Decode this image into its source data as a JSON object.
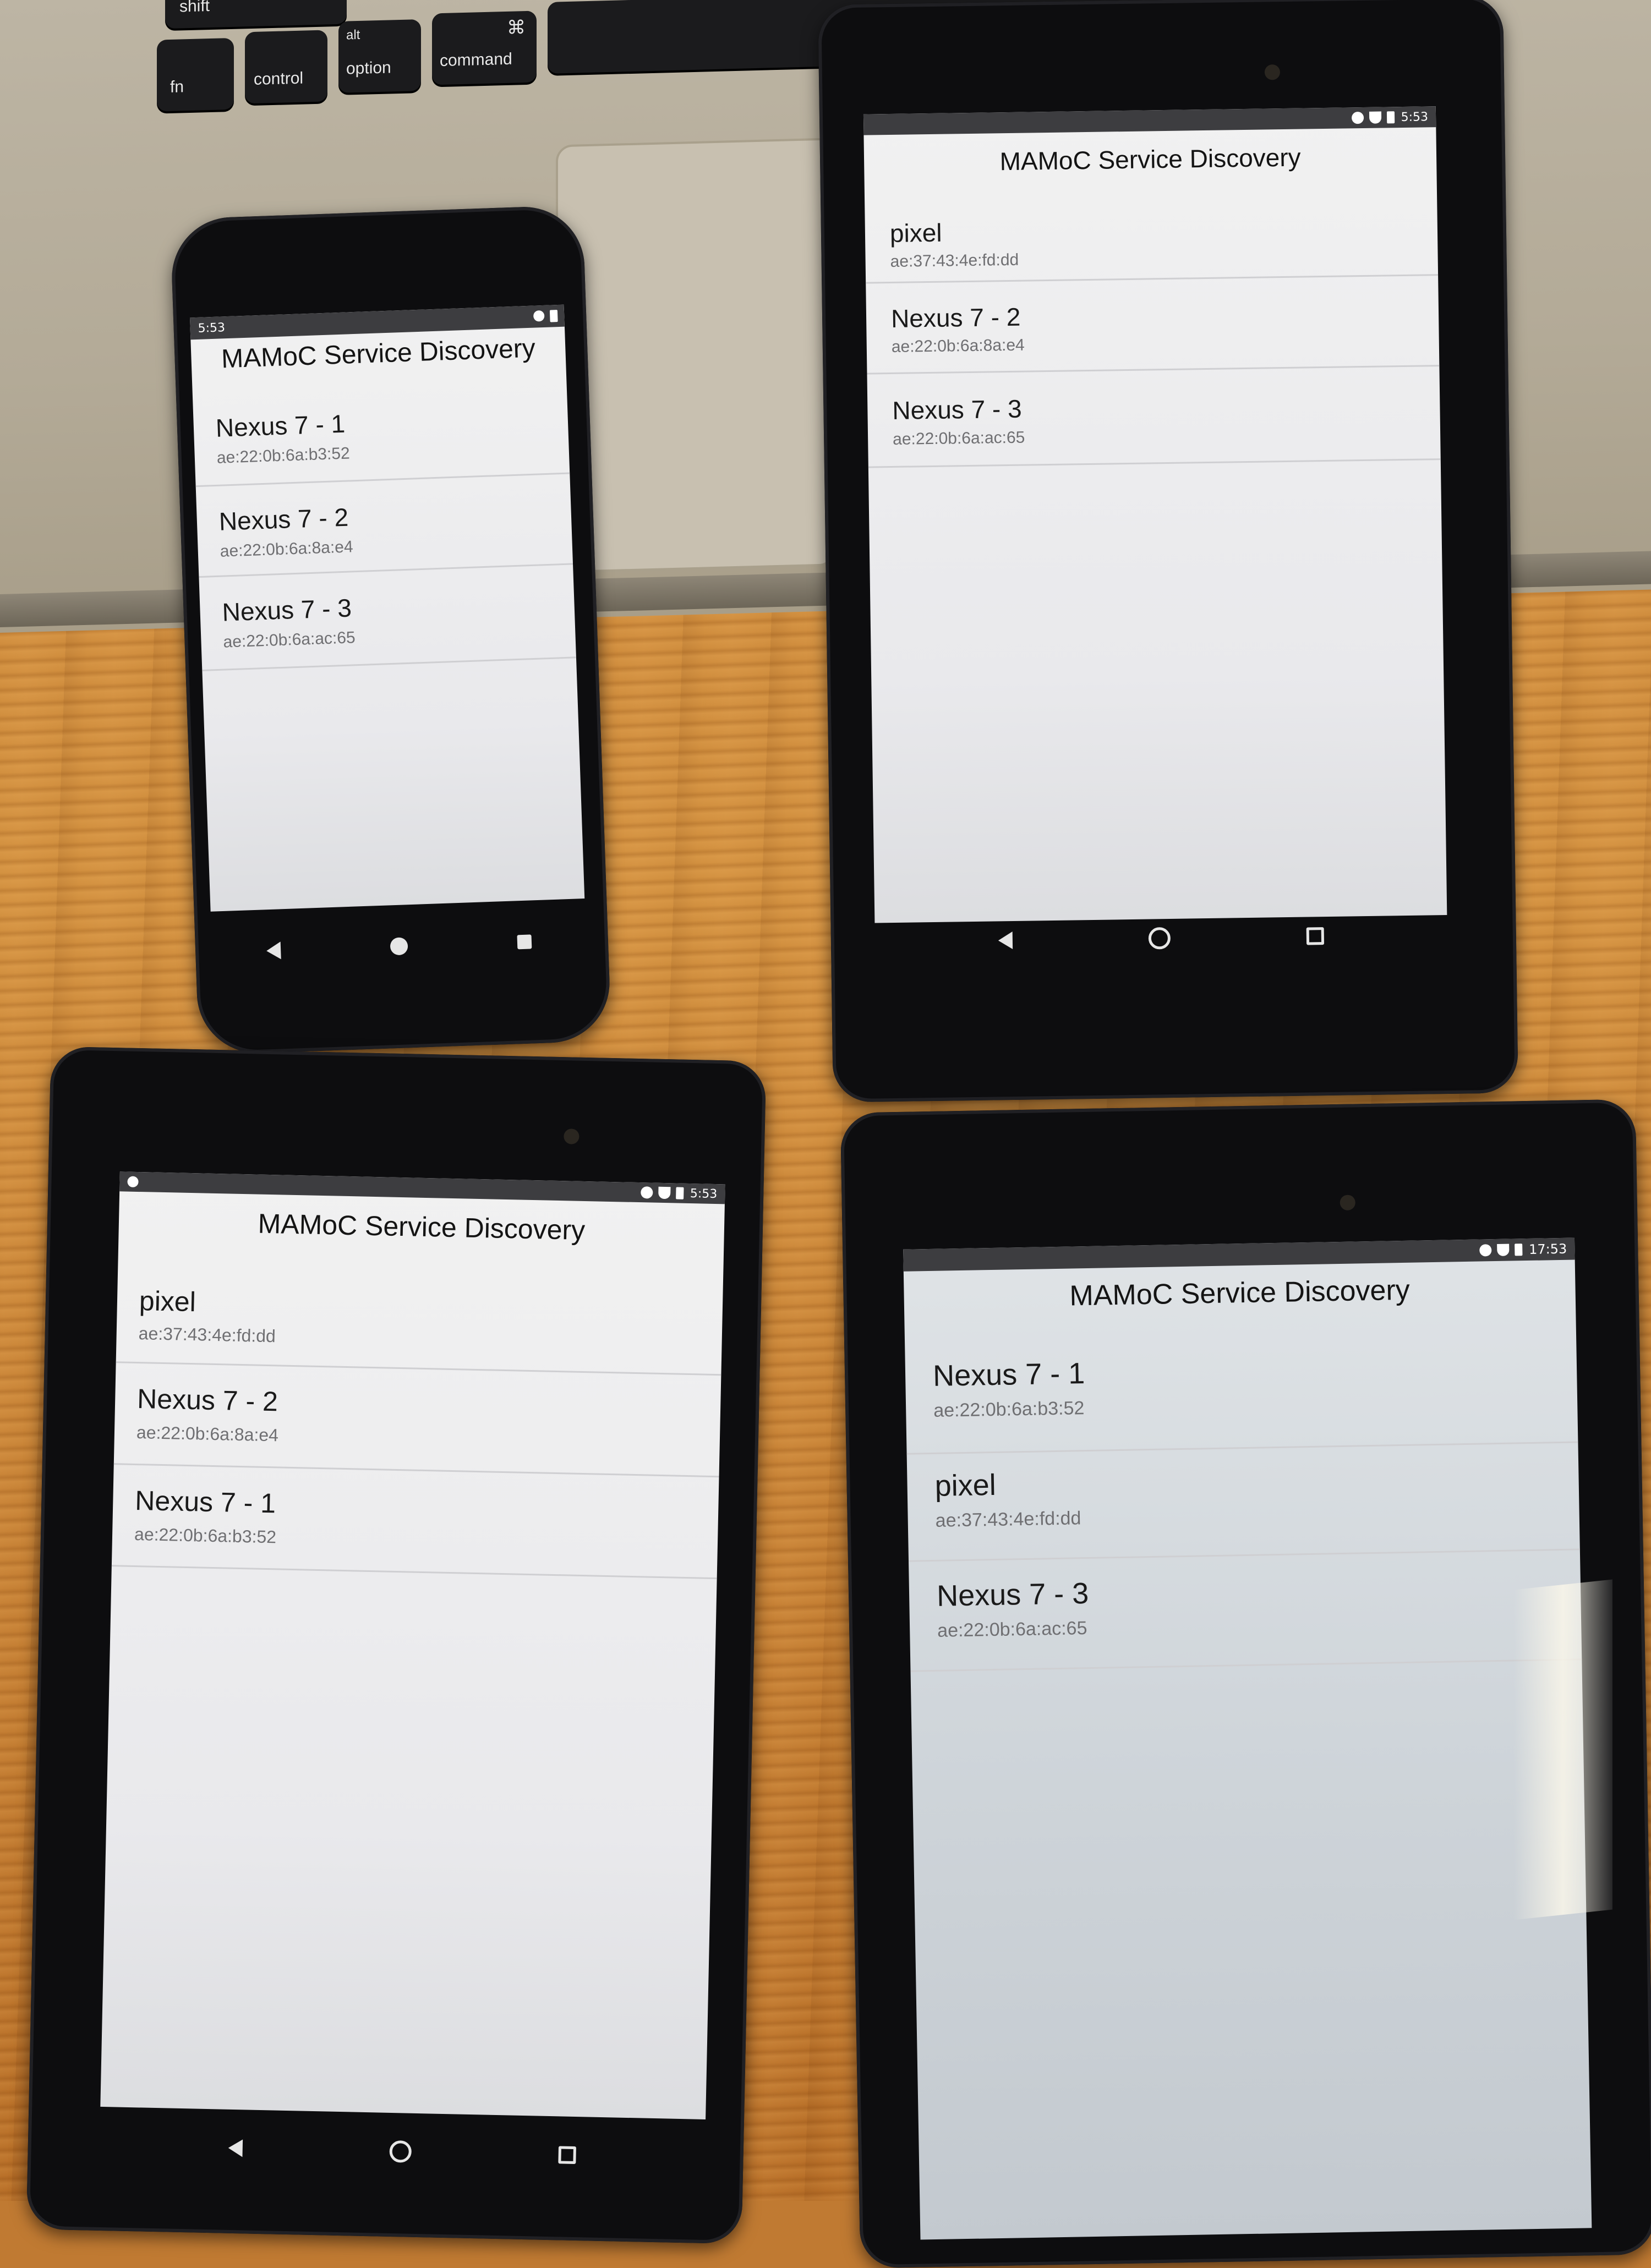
{
  "laptop": {
    "keys": {
      "shift": "shift",
      "fn": "fn",
      "control": "control",
      "alt": "alt",
      "option": "option",
      "cmd_symbol": "⌘",
      "command": "command"
    }
  },
  "devices": [
    {
      "id": "phone",
      "status_time": "5:53",
      "title": "MAMoC Service Discovery",
      "items": [
        {
          "name": "Nexus 7 - 1",
          "address": "ae:22:0b:6a:b3:52"
        },
        {
          "name": "Nexus 7 - 2",
          "address": "ae:22:0b:6a:8a:e4"
        },
        {
          "name": "Nexus 7 - 3",
          "address": "ae:22:0b:6a:ac:65"
        }
      ]
    },
    {
      "id": "tablet-top-right",
      "status_time": "5:53",
      "title": "MAMoC Service Discovery",
      "items": [
        {
          "name": "pixel",
          "address": "ae:37:43:4e:fd:dd"
        },
        {
          "name": "Nexus 7 - 2",
          "address": "ae:22:0b:6a:8a:e4"
        },
        {
          "name": "Nexus 7 - 3",
          "address": "ae:22:0b:6a:ac:65"
        }
      ]
    },
    {
      "id": "tablet-bottom-left",
      "status_time": "5:53",
      "title": "MAMoC Service Discovery",
      "items": [
        {
          "name": "pixel",
          "address": "ae:37:43:4e:fd:dd"
        },
        {
          "name": "Nexus 7 - 2",
          "address": "ae:22:0b:6a:8a:e4"
        },
        {
          "name": "Nexus 7 - 1",
          "address": "ae:22:0b:6a:b3:52"
        }
      ]
    },
    {
      "id": "tablet-bottom-right",
      "status_time": "17:53",
      "title": "MAMoC Service Discovery",
      "items": [
        {
          "name": "Nexus 7 - 1",
          "address": "ae:22:0b:6a:b3:52"
        },
        {
          "name": "pixel",
          "address": "ae:37:43:4e:fd:dd"
        },
        {
          "name": "Nexus 7 - 3",
          "address": "ae:22:0b:6a:ac:65"
        }
      ]
    }
  ]
}
